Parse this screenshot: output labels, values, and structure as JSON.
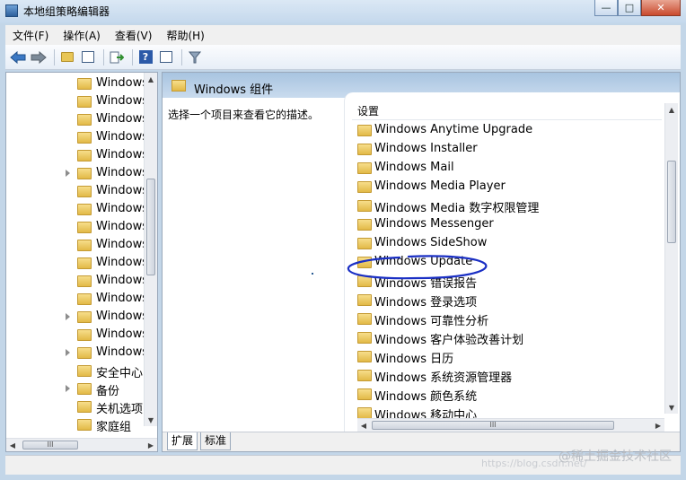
{
  "window": {
    "title": "本地组策略编辑器",
    "buttons": {
      "minimize": "—",
      "maximize": "□",
      "close": "✕"
    }
  },
  "menu": [
    "文件(F)",
    "操作(A)",
    "查看(V)",
    "帮助(H)"
  ],
  "toolbar": {
    "icons": [
      "back-arrow-icon",
      "forward-arrow-icon",
      "up-folder-icon",
      "show-hide-tree-icon",
      "export-icon",
      "help-icon",
      "properties-icon",
      "filter-icon"
    ]
  },
  "tree": {
    "items": [
      {
        "label": "Windows",
        "expandable": false
      },
      {
        "label": "Windows",
        "expandable": false
      },
      {
        "label": "Windows",
        "expandable": false
      },
      {
        "label": "Windows",
        "expandable": false
      },
      {
        "label": "Windows",
        "expandable": false
      },
      {
        "label": "Windows",
        "expandable": true
      },
      {
        "label": "Windows",
        "expandable": false
      },
      {
        "label": "Windows",
        "expandable": false
      },
      {
        "label": "Windows",
        "expandable": false
      },
      {
        "label": "Windows",
        "expandable": false
      },
      {
        "label": "Windows",
        "expandable": false
      },
      {
        "label": "Windows",
        "expandable": false
      },
      {
        "label": "Windows",
        "expandable": false
      },
      {
        "label": "Windows",
        "expandable": true
      },
      {
        "label": "Windows",
        "expandable": false
      },
      {
        "label": "Windows",
        "expandable": true
      },
      {
        "label": "安全中心",
        "expandable": false
      },
      {
        "label": "备份",
        "expandable": true
      },
      {
        "label": "关机选项",
        "expandable": false
      },
      {
        "label": "家庭组",
        "expandable": false
      }
    ]
  },
  "pane": {
    "title": "Windows 组件",
    "description": "选择一个项目来查看它的描述。",
    "column_header": "设置",
    "settings": [
      "Windows Anytime Upgrade",
      "Windows Installer",
      "Windows Mail",
      "Windows Media Player",
      "Windows Media 数字权限管理",
      "Windows Messenger",
      "Windows SideShow",
      "Windows Update",
      "Windows 错误报告",
      "Windows 登录选项",
      "Windows 可靠性分析",
      "Windows 客户体验改善计划",
      "Windows 日历",
      "Windows 系统资源管理器",
      "Windows 颜色系统",
      "Windows 移动中心"
    ],
    "tabs": [
      "扩展",
      "标准"
    ],
    "active_tab": "扩展"
  },
  "watermark": {
    "main": "@稀土掘金技术社区",
    "sub": "https://blog.csdn.net/"
  },
  "annotation": {
    "circled_item": "Windows Update",
    "color": "#1a2fc4"
  }
}
